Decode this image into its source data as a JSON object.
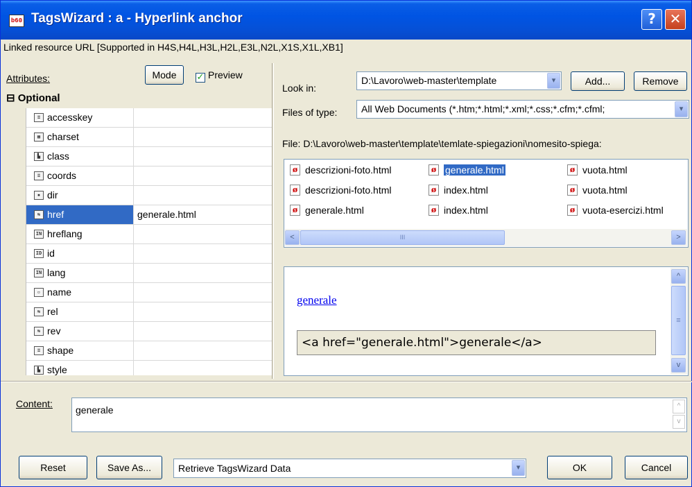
{
  "window": {
    "app_icon": "b60",
    "title": "TagsWizard : a - Hyperlink anchor",
    "help_button": "?",
    "close_button": "✕",
    "subtitle": "Linked resource URL  [Supported in H4S,H4L,H3L,H2L,E3L,N2L,X1S,X1L,XB1]"
  },
  "attributes": {
    "label": "Attributes:",
    "mode_button": "Mode",
    "preview_label": "Preview",
    "preview_checked": true,
    "group_toggle": "⊟",
    "group_label": "Optional",
    "rows": [
      {
        "name": "accesskey",
        "value": "",
        "icon": "≡"
      },
      {
        "name": "charset",
        "value": "",
        "icon": "▦"
      },
      {
        "name": "class",
        "value": "",
        "icon": "▙"
      },
      {
        "name": "coords",
        "value": "",
        "icon": "≡"
      },
      {
        "name": "dir",
        "value": "",
        "icon": "▪"
      },
      {
        "name": "href",
        "value": "generale.html",
        "icon": "⇆"
      },
      {
        "name": "hreflang",
        "value": "",
        "icon": "IN"
      },
      {
        "name": "id",
        "value": "",
        "icon": "ID"
      },
      {
        "name": "lang",
        "value": "",
        "icon": "IN"
      },
      {
        "name": "name",
        "value": "",
        "icon": "▫"
      },
      {
        "name": "rel",
        "value": "",
        "icon": "⇆"
      },
      {
        "name": "rev",
        "value": "",
        "icon": "⇆"
      },
      {
        "name": "shape",
        "value": "",
        "icon": "≡"
      },
      {
        "name": "style",
        "value": "",
        "icon": "▙"
      }
    ]
  },
  "browser": {
    "look_in_label": "Look in:",
    "look_in_value": "D:\\Lavoro\\web-master\\template",
    "add_button": "Add...",
    "remove_button": "Remove",
    "files_type_label": "Files of type:",
    "files_type_value": "All Web Documents (*.htm;*.html;*.xml;*.css;*.cfm;*.cfml;",
    "file_path": "File: D:\\Lavoro\\web-master\\template\\temlate-spiegazioni\\nomesito-spiega:",
    "file_icon": "ø",
    "files": [
      [
        "descrizioni-foto.html",
        "generale.html",
        "vuota.html"
      ],
      [
        "descrizioni-foto.html",
        "index.html",
        "vuota.html"
      ],
      [
        "generale.html",
        "index.html",
        "vuota-esercizi.html"
      ]
    ],
    "scroll_left": "<",
    "scroll_right": ">",
    "scroll_grip": "III"
  },
  "preview": {
    "link_text": "generale",
    "code": "<a href=\"generale.html\">generale</a>",
    "scroll_up": "^",
    "scroll_down": "v",
    "scroll_grip": "≡"
  },
  "content": {
    "label": "Content:",
    "value": "generale",
    "scroll_up": "^",
    "scroll_down": "v"
  },
  "footer": {
    "reset_button": "Reset",
    "save_as_button": "Save As...",
    "action_select": "Retrieve TagsWizard Data",
    "ok_button": "OK",
    "cancel_button": "Cancel",
    "combo_arrow": "▾"
  },
  "colors": {
    "titlebar": "#0054e3",
    "selection": "#316ac5",
    "window_bg": "#ece9d8",
    "link": "#0000ee"
  }
}
